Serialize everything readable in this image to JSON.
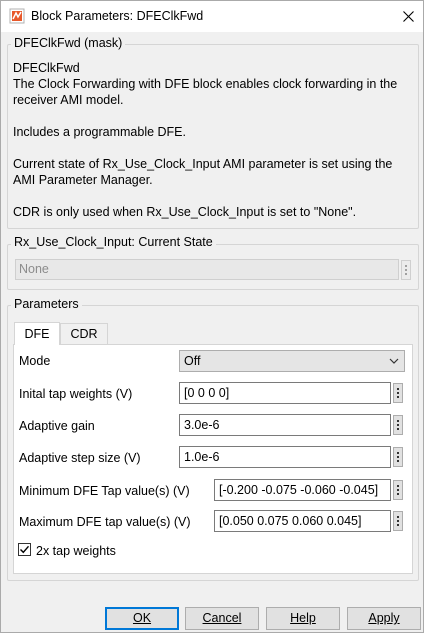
{
  "window": {
    "title": "Block Parameters: DFEClkFwd"
  },
  "description": {
    "legend": "DFEClkFwd (mask)",
    "lines": [
      "DFEClkFwd",
      "The Clock Forwarding with DFE block enables clock forwarding in the",
      "receiver AMI model.",
      "Includes a programmable DFE.",
      "Current state of Rx_Use_Clock_Input AMI parameter is set using the",
      "AMI Parameter Manager.",
      "CDR is only used when Rx_Use_Clock_Input is set to \"None\"."
    ]
  },
  "clock_input": {
    "label": "Rx_Use_Clock_Input: Current State",
    "value": "None"
  },
  "parameters": {
    "legend": "Parameters",
    "tabs": [
      "DFE",
      "CDR"
    ],
    "active_tab": "DFE",
    "mode_label": "Mode",
    "mode_value": "Off",
    "initial_tap_label": "Inital tap weights (V)",
    "initial_tap_value": "[0 0 0 0]",
    "adaptive_gain_label": "Adaptive gain",
    "adaptive_gain_value": "3.0e-6",
    "adaptive_step_label": "Adaptive step size (V)",
    "adaptive_step_value": "1.0e-6",
    "min_tap_label": "Minimum DFE Tap value(s) (V)",
    "min_tap_value": "[-0.200 -0.075 -0.060 -0.045]",
    "max_tap_label": "Maximum DFE tap value(s) (V)",
    "max_tap_value": "[0.050 0.075 0.060 0.045]",
    "two_x_label": "2x tap weights",
    "two_x_checked": true
  },
  "buttons": {
    "ok": "OK",
    "cancel": "Cancel",
    "help": "Help",
    "apply": "Apply"
  }
}
